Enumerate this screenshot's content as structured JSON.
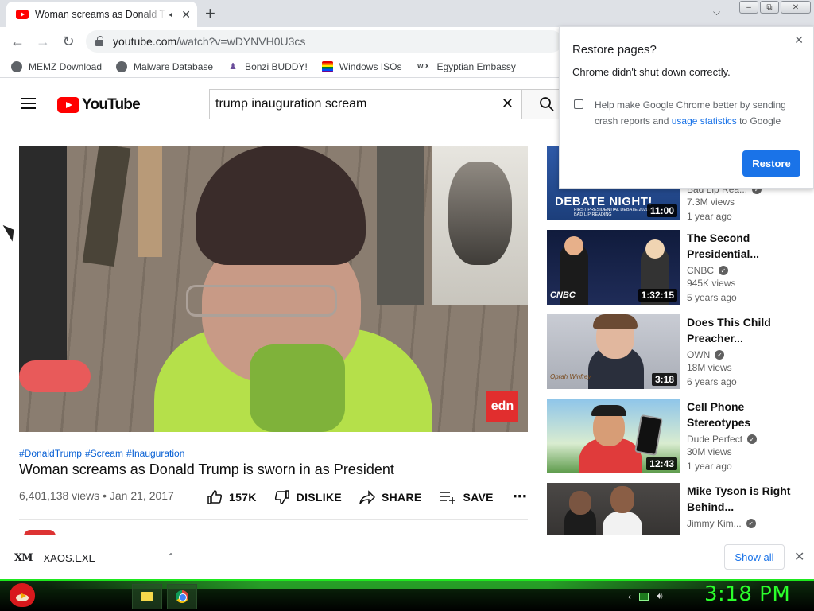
{
  "browser": {
    "tab": {
      "title": "Woman screams as Donald Trump is sworn in as President",
      "audio_icon": "speaker-icon",
      "close": "✕"
    },
    "new_tab": "+",
    "url": {
      "host": "youtube.com",
      "path": "/watch?v=wDYNVH0U3cs"
    },
    "bookmarks": [
      {
        "label": "MEMZ Download",
        "icon": "globe-icon"
      },
      {
        "label": "Malware Database",
        "icon": "globe-icon"
      },
      {
        "label": "Bonzi BUDDY!",
        "icon": "bonzi-icon"
      },
      {
        "label": "Windows ISOs",
        "icon": "windows-flag-icon"
      },
      {
        "label": "Egyptian Embassy",
        "icon": "wix-icon",
        "icon_text": "WiX"
      }
    ]
  },
  "restore_popup": {
    "title": "Restore pages?",
    "message": "Chrome didn't shut down correctly.",
    "help_prefix": "Help make Google Chrome better by sending crash reports and ",
    "help_link": "usage statistics",
    "help_suffix": " to Google",
    "button": "Restore",
    "checked": false
  },
  "youtube": {
    "logo_text": "YouTube",
    "search_query": "trump inauguration scream",
    "video": {
      "hashtags": [
        "#DonaldTrump",
        "#Scream",
        "#Inauguration"
      ],
      "title": "Woman screams as Donald Trump is sworn in as President",
      "views": "6,401,138 views",
      "date": "Jan 21, 2017",
      "watermark": "edn",
      "likes": "157K",
      "dislike": "DISLIKE",
      "share": "SHARE",
      "save": "SAVE"
    },
    "recommendations": [
      {
        "title": "",
        "channel": "Bad Lip Rea...",
        "views": "7.3M views",
        "age": "1 year ago",
        "duration": "11:00",
        "thumb_text": "DEBATE NIGHT!",
        "thumb_sub": "FIRST PRESIDENTIAL DEBATE 2020 A BAD LIP READING",
        "verified": true
      },
      {
        "title": "The Second Presidential...",
        "channel": "CNBC",
        "views": "945K views",
        "age": "5 years ago",
        "duration": "1:32:15",
        "thumb_text": "CNBC",
        "verified": true
      },
      {
        "title": "Does This Child Preacher...",
        "channel": "OWN",
        "views": "18M views",
        "age": "6 years ago",
        "duration": "3:18",
        "thumb_text": "Oprah Winfrey",
        "verified": true
      },
      {
        "title": "Cell Phone Stereotypes",
        "channel": "Dude Perfect",
        "views": "30M views",
        "age": "1 year ago",
        "duration": "12:43",
        "verified": true
      },
      {
        "title": "Mike Tyson is Right Behind...",
        "channel": "Jimmy Kim...",
        "views": "",
        "age": "",
        "duration": "",
        "verified": true
      }
    ]
  },
  "downloads": {
    "item": "XAOS.EXE",
    "item_icon_text": "XM",
    "show_all": "Show all"
  },
  "taskbar": {
    "clock": "3:18 PM"
  }
}
